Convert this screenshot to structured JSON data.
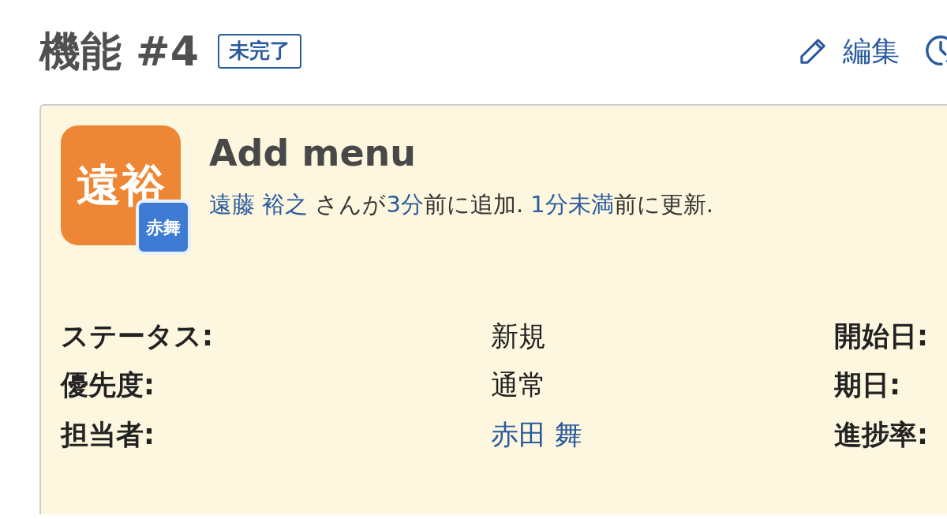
{
  "heading": {
    "title": "機能 #4",
    "status": "未完了"
  },
  "actions": [
    {
      "label": "編集",
      "kind": "edit"
    },
    {
      "kind": "log-time"
    }
  ],
  "issue": {
    "author_avatar": "遠裕",
    "assignee_avatar": "赤舞",
    "subject": "Add menu",
    "byline": [
      {
        "text": "遠藤 裕之",
        "kind": "link"
      },
      {
        "text": " さんが",
        "kind": "text"
      },
      {
        "text": "3分",
        "kind": "link"
      },
      {
        "text": "前に追加. ",
        "kind": "text"
      },
      {
        "text": "1分未満",
        "kind": "link"
      },
      {
        "text": "前に更新.",
        "kind": "text"
      }
    ],
    "attributes": [
      {
        "label": "ステータス:",
        "value": "新規",
        "kind": "text",
        "side_label": "開始日:"
      },
      {
        "label": "優先度:",
        "value": "通常",
        "kind": "text",
        "side_label": "期日:"
      },
      {
        "label": "担当者:",
        "value": "赤田 舞",
        "kind": "link",
        "side_label": "進捗率:"
      }
    ]
  }
}
